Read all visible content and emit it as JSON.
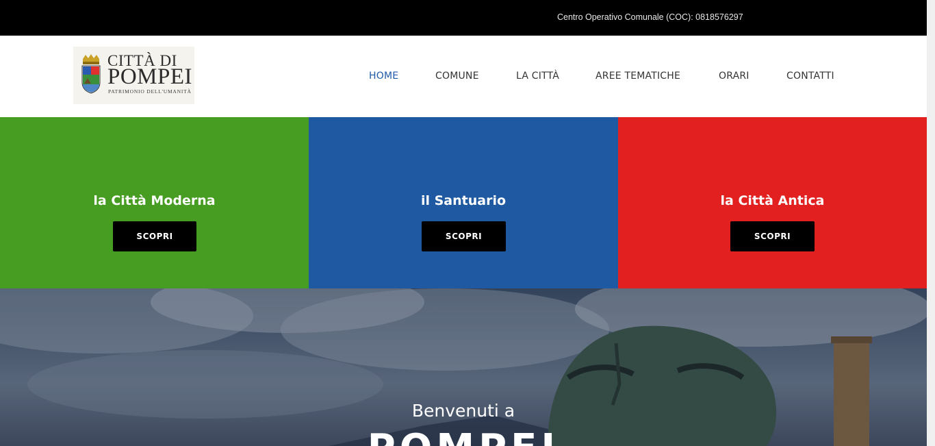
{
  "top_bar": {
    "coc_text": "Centro Operativo Comunale (COC): 0818576297"
  },
  "logo": {
    "line1": "CITTÀ DI",
    "line2": "POMPEI",
    "line3": "PATRIMONIO DELL'UMANITÀ"
  },
  "nav": {
    "items": [
      {
        "label": "HOME",
        "active": true
      },
      {
        "label": "COMUNE",
        "active": false
      },
      {
        "label": "LA CITTÀ",
        "active": false
      },
      {
        "label": "AREE TEMATICHE",
        "active": false
      },
      {
        "label": "ORARI",
        "active": false
      },
      {
        "label": "CONTATTI",
        "active": false
      }
    ],
    "active_color": "#1e5aa8"
  },
  "panels": [
    {
      "title": "la Città Moderna",
      "button": "SCOPRI",
      "color": "#479c22"
    },
    {
      "title": "il Santuario",
      "button": "SCOPRI",
      "color": "#1e59a1"
    },
    {
      "title": "la Città Antica",
      "button": "SCOPRI",
      "color": "#e32020"
    }
  ],
  "hero": {
    "welcome": "Benvenuti a",
    "title": "POMPEI"
  }
}
